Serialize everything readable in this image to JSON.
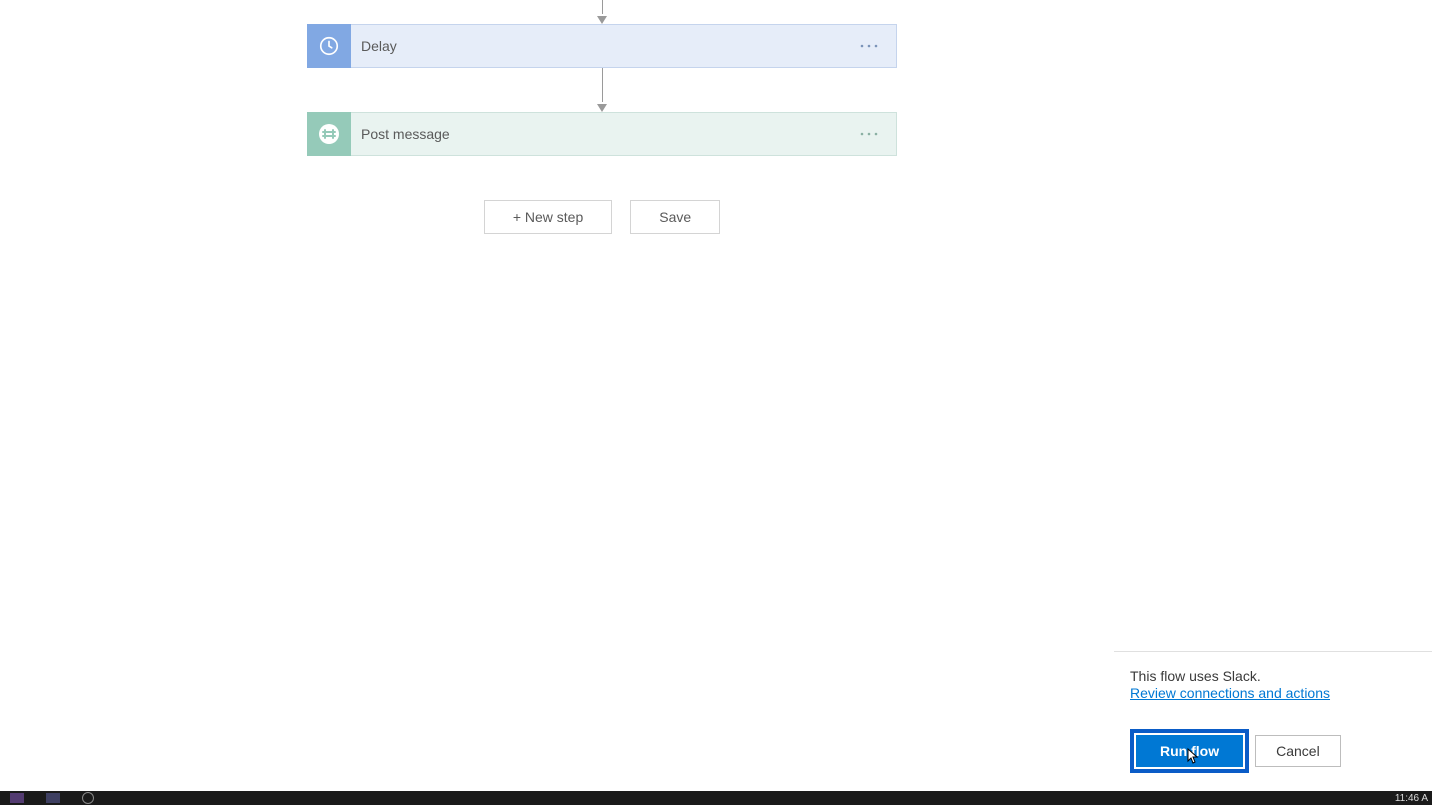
{
  "flow": {
    "steps": [
      {
        "label": "Delay",
        "icon": "clock-icon"
      },
      {
        "label": "Post message",
        "icon": "hash-icon"
      }
    ],
    "new_step_label": "+ New step",
    "save_label": "Save"
  },
  "panel": {
    "info_text": "This flow uses Slack.",
    "link_text": "Review connections and actions",
    "run_label": "Run flow",
    "cancel_label": "Cancel"
  },
  "taskbar": {
    "time": "11:46 A"
  }
}
